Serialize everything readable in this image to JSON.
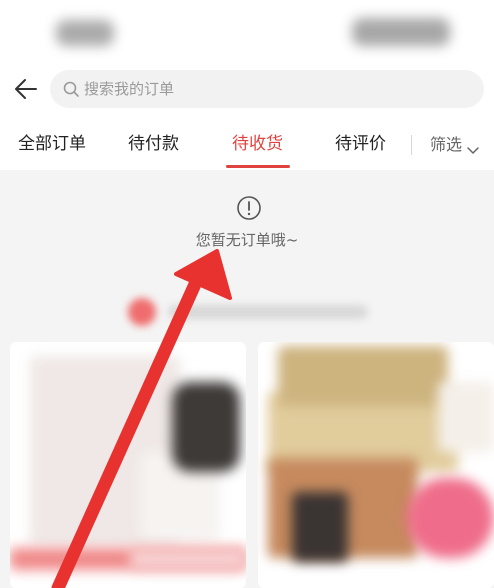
{
  "search": {
    "placeholder": "搜索我的订单"
  },
  "tabs": [
    {
      "label": "全部订单",
      "active": false
    },
    {
      "label": "待付款",
      "active": false
    },
    {
      "label": "待收货",
      "active": true
    },
    {
      "label": "待评价",
      "active": false
    }
  ],
  "filter": {
    "label": "筛选"
  },
  "empty_state": {
    "message": "您暂无订单哦~"
  },
  "colors": {
    "accent": "#e0433f",
    "annotation_arrow": "#e8322f"
  },
  "icons": {
    "back": "back-arrow-icon",
    "search": "search-icon",
    "filter": "chevron-down-icon",
    "empty": "info-circle-icon"
  }
}
